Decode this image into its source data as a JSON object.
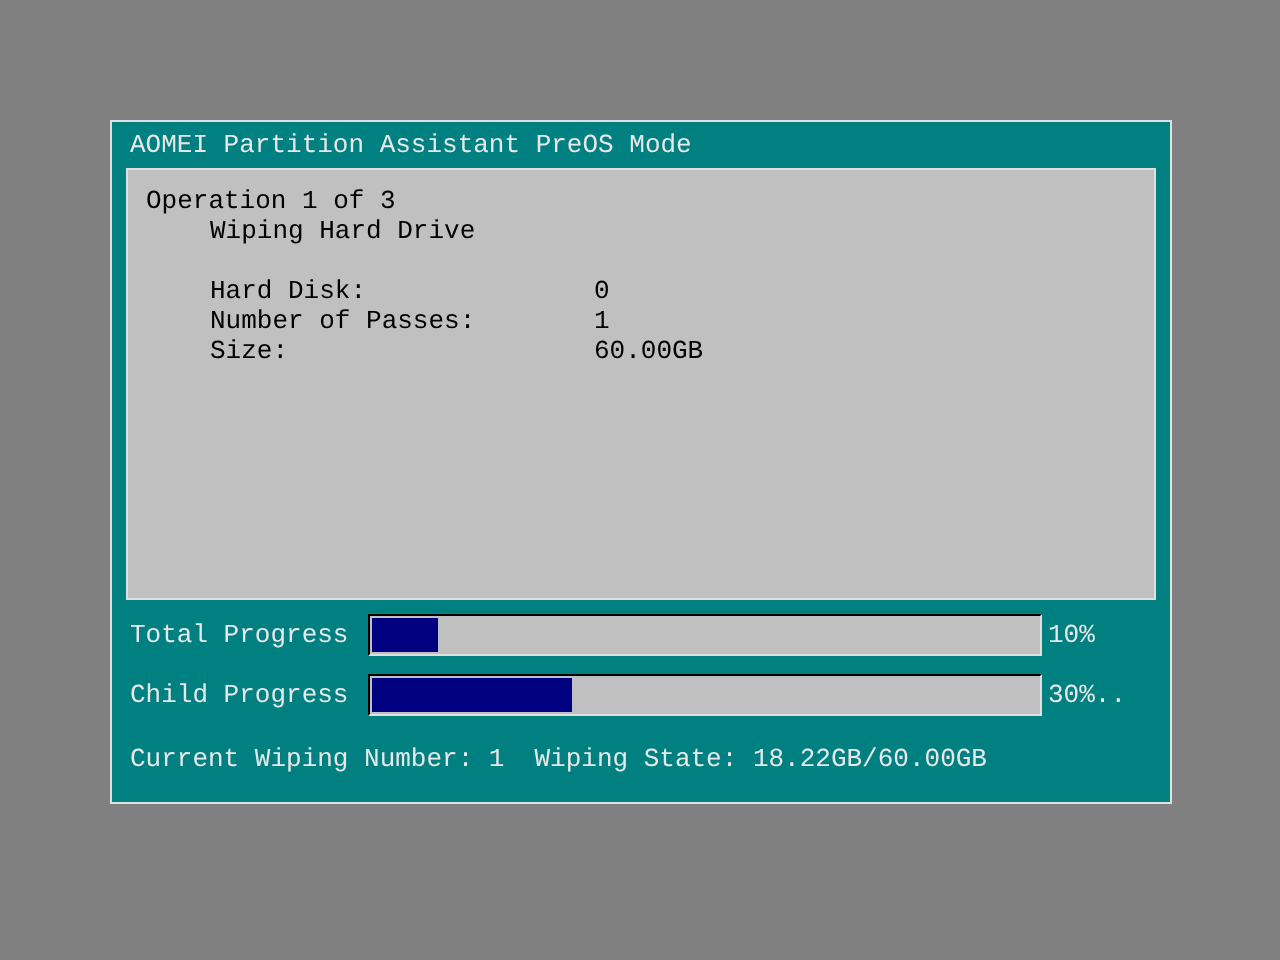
{
  "window": {
    "title": "AOMEI Partition Assistant PreOS Mode"
  },
  "operation": {
    "heading": "Operation 1 of 3",
    "task": "Wiping Hard Drive",
    "details": [
      {
        "label": "Hard Disk:",
        "value": "0"
      },
      {
        "label": "Number of Passes:",
        "value": "1"
      },
      {
        "label": "Size:",
        "value": "60.00GB"
      }
    ]
  },
  "progress": [
    {
      "label": "Total Progress",
      "level": 0.1,
      "reading": "10%"
    },
    {
      "label": "Child Progress",
      "level": 0.3,
      "reading": "30%.."
    }
  ],
  "status": {
    "wiping_number": "Current Wiping Number: 1",
    "wiping_state": "Wiping State: 18.22GB/60.00GB"
  }
}
